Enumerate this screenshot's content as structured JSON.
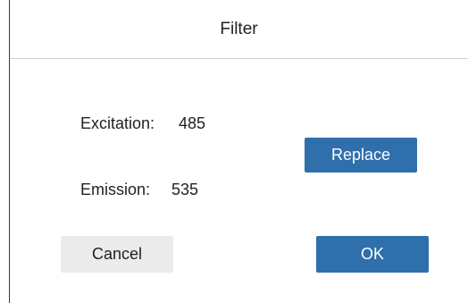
{
  "dialog": {
    "title": "Filter"
  },
  "fields": {
    "excitation": {
      "label": "Excitation:",
      "value": "485"
    },
    "emission": {
      "label": "Emission:",
      "value": "535"
    }
  },
  "buttons": {
    "replace": "Replace",
    "cancel": "Cancel",
    "ok": "OK"
  },
  "colors": {
    "primary": "#2f6fac",
    "secondary": "#ebebeb",
    "divider": "#cfcfcf"
  }
}
